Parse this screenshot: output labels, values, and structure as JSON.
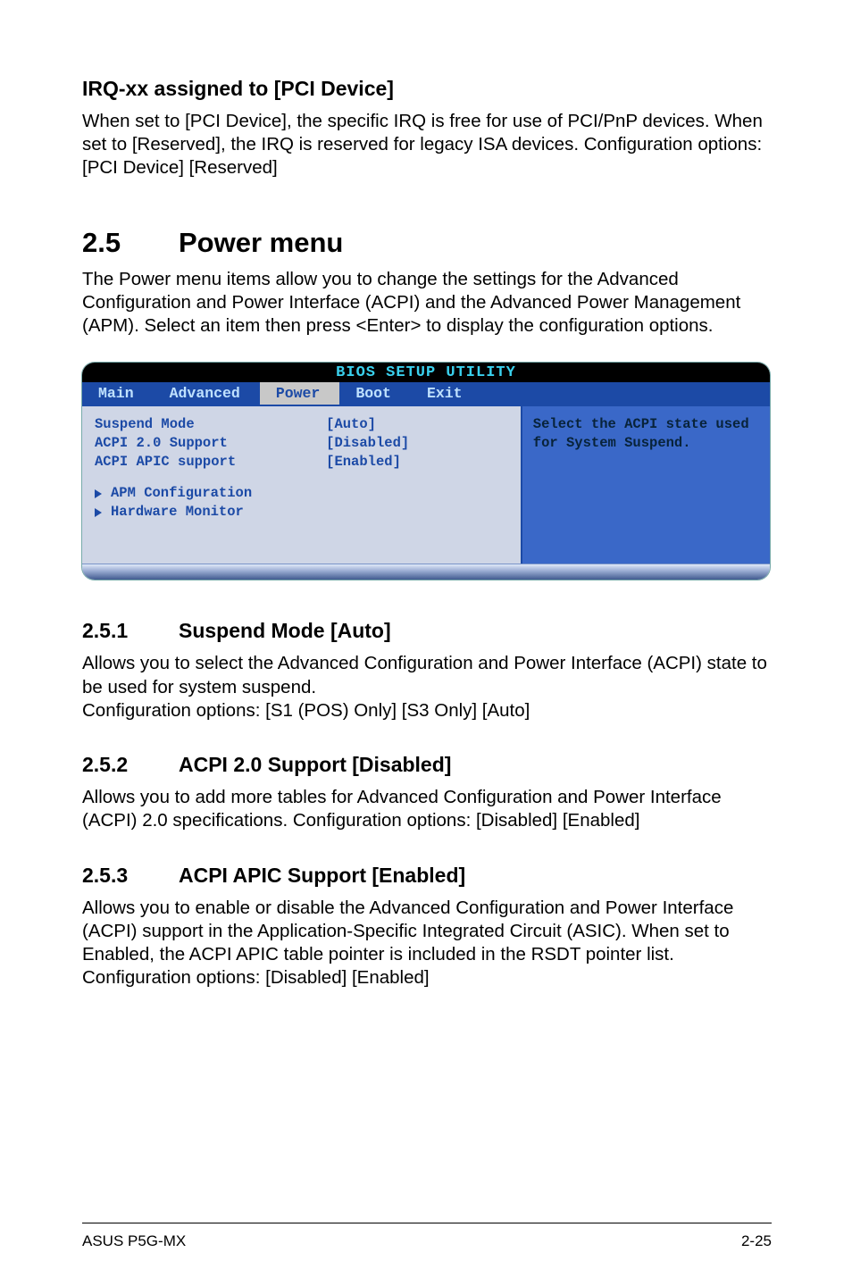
{
  "section_irq": {
    "heading": "IRQ-xx assigned to [PCI Device]",
    "body": "When set to [PCI Device], the specific IRQ is free for use of PCI/PnP devices. When set to [Reserved], the IRQ is reserved for legacy ISA devices. Configuration options: [PCI Device] [Reserved]"
  },
  "chapter": {
    "num": "2.5",
    "title": "Power menu",
    "intro": "The Power menu items allow you to change the settings for the Advanced Configuration and Power Interface (ACPI) and the Advanced Power Management (APM). Select an item then press <Enter> to display the configuration options."
  },
  "bios": {
    "title": "BIOS SETUP UTILITY",
    "tabs": [
      "Main",
      "Advanced",
      "Power",
      "Boot",
      "Exit"
    ],
    "active_tab": "Power",
    "rows": [
      {
        "label": "Suspend Mode",
        "value": "[Auto]"
      },
      {
        "label": "ACPI 2.0 Support",
        "value": "[Disabled]"
      },
      {
        "label": "ACPI APIC support",
        "value": "[Enabled]"
      }
    ],
    "submenus": [
      "APM Configuration",
      "Hardware Monitor"
    ],
    "help": "Select the ACPI state used for System Suspend."
  },
  "sections": [
    {
      "num": "2.5.1",
      "title": "Suspend Mode [Auto]",
      "body": "Allows you to select the Advanced Configuration and Power Interface (ACPI) state to be used for system suspend.\nConfiguration options: [S1 (POS) Only] [S3 Only] [Auto]"
    },
    {
      "num": "2.5.2",
      "title": "ACPI 2.0 Support [Disabled]",
      "body": "Allows you to add more tables for Advanced Configuration and Power Interface (ACPI) 2.0 specifications. Configuration options: [Disabled] [Enabled]"
    },
    {
      "num": "2.5.3",
      "title": "ACPI APIC Support [Enabled]",
      "body": "Allows you to enable or disable the Advanced Configuration and Power Interface (ACPI) support in the Application-Specific Integrated Circuit (ASIC). When set to Enabled, the ACPI APIC table pointer is included in the RSDT pointer list. Configuration options: [Disabled] [Enabled]"
    }
  ],
  "footer": {
    "left": "ASUS P5G-MX",
    "right": "2-25"
  }
}
